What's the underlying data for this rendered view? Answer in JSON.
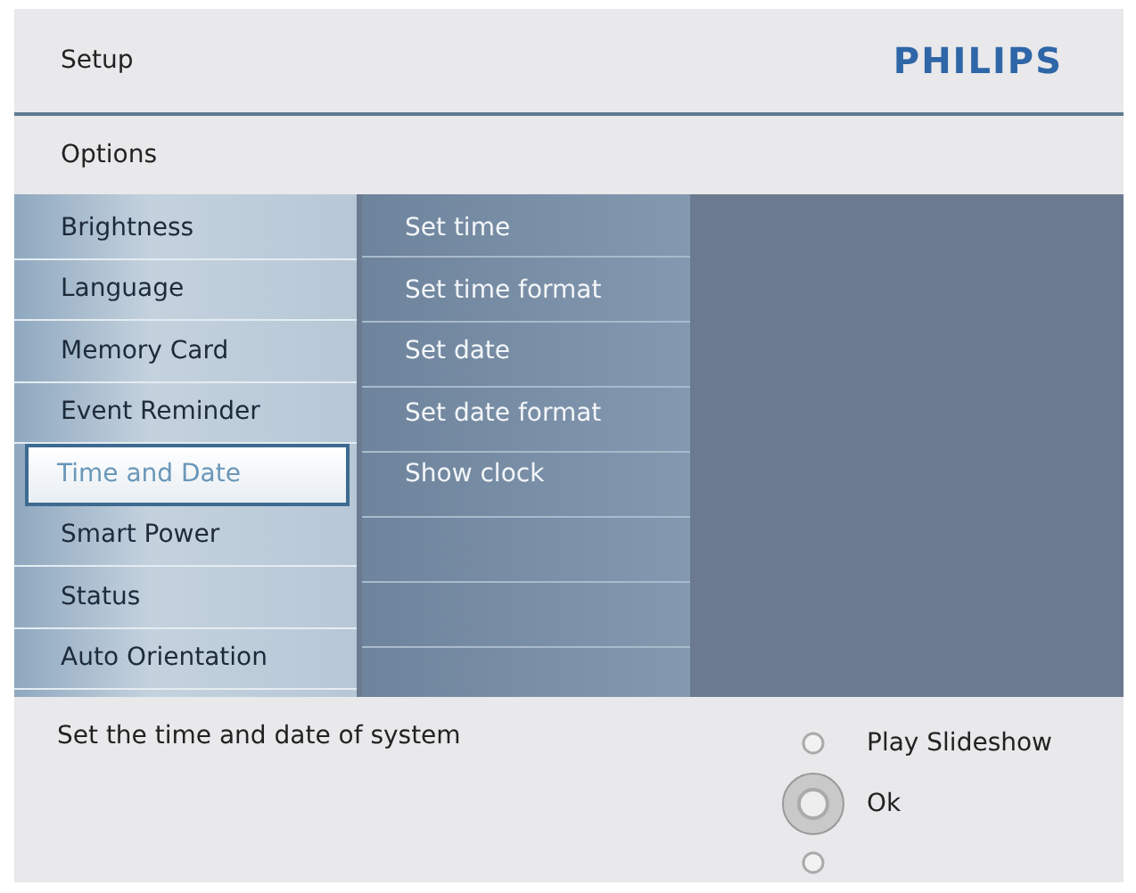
{
  "header": {
    "title": "Setup",
    "brand": "PHILIPS"
  },
  "subheader": {
    "title": "Options"
  },
  "menu": [
    {
      "label": "Brightness",
      "selected": false
    },
    {
      "label": "Language",
      "selected": false
    },
    {
      "label": "Memory Card",
      "selected": false
    },
    {
      "label": "Event Reminder",
      "selected": false
    },
    {
      "label": "Time and Date",
      "selected": true
    },
    {
      "label": "Smart Power",
      "selected": false
    },
    {
      "label": "Status",
      "selected": false
    },
    {
      "label": "Auto Orientation",
      "selected": false
    }
  ],
  "submenu": [
    "Set time",
    "Set time format",
    "Set date",
    "Set date format",
    "Show clock"
  ],
  "help": {
    "text": "Set the time and date of system",
    "keys": [
      {
        "kind": "up",
        "label": "Play Slideshow"
      },
      {
        "kind": "ok",
        "label": "Ok"
      },
      {
        "kind": "down"
      }
    ]
  }
}
